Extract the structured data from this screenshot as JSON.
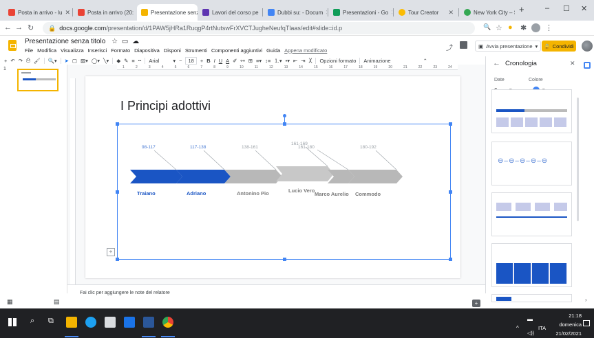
{
  "tabs": [
    {
      "label": "Posta in arrivo - lu",
      "color": "#ea4335"
    },
    {
      "label": "Posta in arrivo (20:",
      "color": "#ea4335"
    },
    {
      "label": "Presentazione senz",
      "color": "#f4b400"
    },
    {
      "label": "Lavori del corso pe",
      "color": "#5e35b1"
    },
    {
      "label": "Dubbi su: - Docum",
      "color": "#4285f4"
    },
    {
      "label": "Presentazioni - Go",
      "color": "#0f9d58"
    },
    {
      "label": "Tour Creator",
      "color": "#fbbc04"
    },
    {
      "label": "New York City – St",
      "color": "#34a853"
    }
  ],
  "window": {
    "minimize": "–",
    "maximize": "☐",
    "close": "✕",
    "new_tab": "+"
  },
  "browser": {
    "url_host": "docs.google.com",
    "url_path": "/presentation/d/1PAW5jHRa1RuqgP4rtNutswFrXVCTJugheNeufqTlaas/edit#slide=id.p"
  },
  "doc": {
    "title": "Presentazione senza titolo",
    "menus": [
      "File",
      "Modifica",
      "Visualizza",
      "Inserisci",
      "Formato",
      "Diapositiva",
      "Disponi",
      "Strumenti",
      "Componenti aggiuntivi",
      "Guida"
    ],
    "last_edit": "Appena modificato",
    "present_label": "Avvia presentazione",
    "share_label": "Condividi"
  },
  "toolbar": {
    "font": "Arial",
    "font_size": "18",
    "format_options": "Opzioni formato",
    "animation": "Animazione"
  },
  "filmstrip": {
    "slide_number": "1"
  },
  "slide": {
    "title": "I Principi adottivi",
    "timeline": [
      {
        "years": "98-117",
        "name": "Traiano",
        "highlight": true
      },
      {
        "years": "117-138",
        "name": "Adriano",
        "highlight": true
      },
      {
        "years": "138-161",
        "name": "Antonino Pio",
        "highlight": false
      },
      {
        "years": "161-169",
        "name": "Lucio Vero",
        "highlight": false
      },
      {
        "years": "161-180",
        "name": "Marco Aurelio",
        "highlight": false
      },
      {
        "years": "180-192",
        "name": "Commodo",
        "highlight": false
      }
    ]
  },
  "notes_placeholder": "Fai clic per aggiungere le note del relatore",
  "history": {
    "title": "Cronologia",
    "date_label": "Date",
    "color_label": "Colore",
    "date_value": "6",
    "accent": "#4285f4"
  },
  "taskbar": {
    "time": "21:18",
    "day": "domenica",
    "date": "21/02/2021",
    "lang": "ITA"
  },
  "colors": {
    "highlight": "#1a55c4",
    "muted": "#b8b8b8",
    "docs_yellow": "#f4b400"
  }
}
